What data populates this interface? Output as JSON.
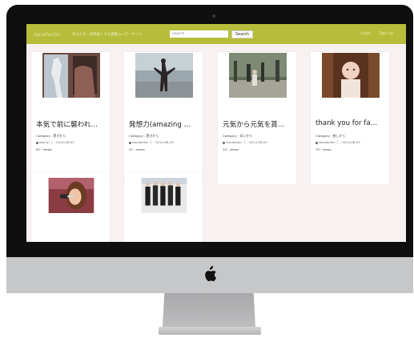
{
  "navbar": {
    "brand": "tanafactor",
    "tagline": "あなたを一段階強くする感動ムービーサイト",
    "search_placeholder": "Search",
    "search_button": "Search",
    "links": [
      "Login",
      "Sign up"
    ]
  },
  "cards": [
    {
      "title": "本気で前に襲われ…",
      "category": "Category : 驚きから",
      "author": "danny ⓘ : 2014-08-03",
      "views": "62 : views"
    },
    {
      "title": "発想力(amazing …",
      "category": "Category : 驚きから",
      "author": "tanafactor ⓘ : 2014-08-03",
      "views": "47 : views"
    },
    {
      "title": "元気から元気を貰…",
      "category": "Category : 笑いから",
      "author": "tanafactor ⓘ : 2014-08-03",
      "views": "20 : views"
    },
    {
      "title": "thank you for fa…",
      "category": "Category : 感しから",
      "author": "tanafactor ⓘ : 2014-08-03",
      "views": "33 : views"
    },
    {
      "title": "",
      "category": "",
      "author": "",
      "views": ""
    },
    {
      "title": "",
      "category": "",
      "author": "",
      "views": ""
    }
  ],
  "colors": {
    "navbar": "#b6bd3a",
    "screen_bg": "#f7f2f1",
    "bezel": "#0f0f0f"
  },
  "icons": [
    "apple-logo-icon",
    "user-icon"
  ]
}
